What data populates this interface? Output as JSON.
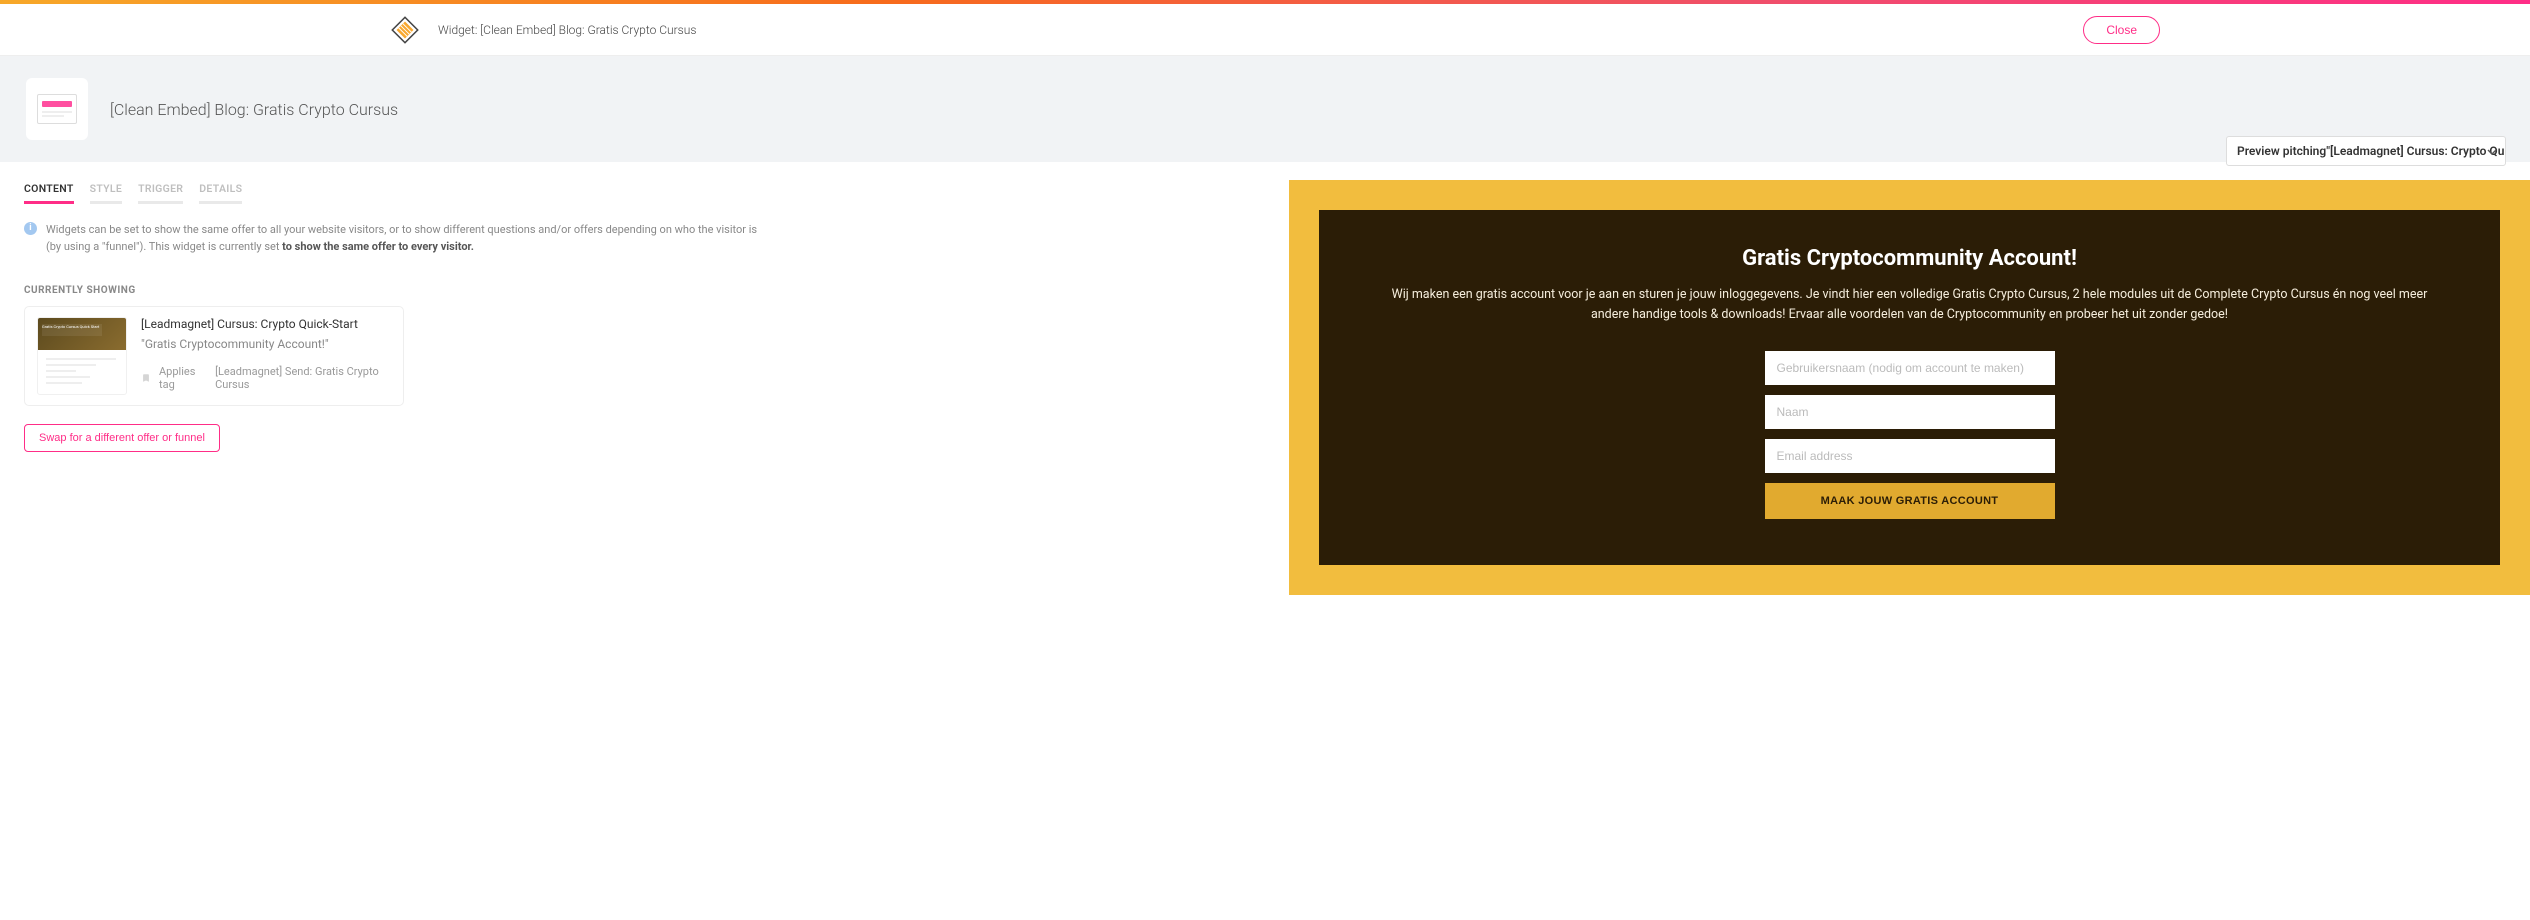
{
  "toolbar": {
    "title": "Widget: [Clean Embed] Blog: Gratis Crypto Cursus",
    "close": "Close"
  },
  "header": {
    "title": "[Clean Embed] Blog: Gratis Crypto Cursus"
  },
  "tabs": {
    "content": "CONTENT",
    "style": "STYLE",
    "trigger": "TRIGGER",
    "details": "DETAILS"
  },
  "preview_select": {
    "prefix": "Preview pitching ",
    "value": "\"[Leadmagnet] Cursus: Crypto Quick-S"
  },
  "info": {
    "text_a": "Widgets can be set to show the same offer to all your website visitors, or to show different questions and/or offers depending on who the visitor is (by using a \"funnel\"). This widget is currently set ",
    "text_b": "to show the same offer to every visitor."
  },
  "currently_showing_label": "CURRENTLY SHOWING",
  "offer": {
    "thumb_text": "Gratis Crypto Cursus Quick Start",
    "title": "[Leadmagnet] Cursus: Crypto Quick-Start",
    "subtitle": "\"Gratis Cryptocommunity Account!\"",
    "applies_tag_label": "Applies tag",
    "applies_tag_value": "[Leadmagnet] Send: Gratis Crypto Cursus"
  },
  "swap_label": "Swap for a different offer or funnel",
  "preview": {
    "title": "Gratis Cryptocommunity Account!",
    "desc": "Wij maken een gratis account voor je aan en sturen je jouw inloggegevens. Je vindt hier een volledige Gratis Crypto Cursus, 2 hele modules uit de Complete Crypto Cursus én nog veel meer andere handige tools & downloads! Ervaar alle voordelen van de Cryptocommunity en probeer het uit zonder gedoe!",
    "placeholders": {
      "username": "Gebruikersnaam (nodig om account te maken)",
      "name": "Naam",
      "email": "Email address"
    },
    "submit": "MAAK JOUW GRATIS ACCOUNT"
  }
}
